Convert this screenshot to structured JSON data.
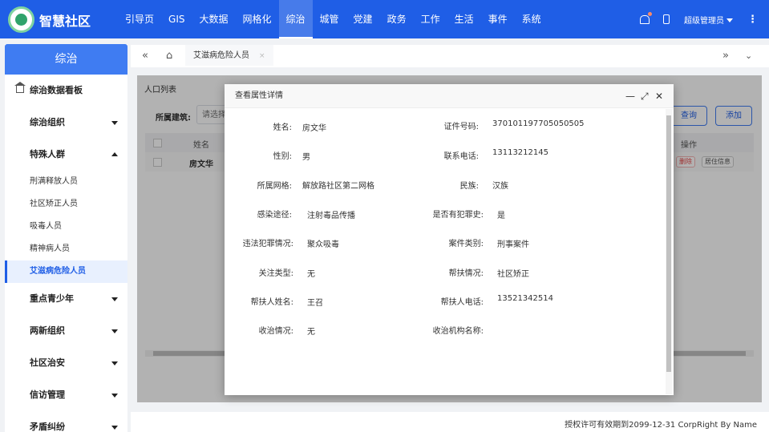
{
  "app": {
    "brand": "智慧社区"
  },
  "nav": [
    {
      "label": "引导页"
    },
    {
      "label": "GIS"
    },
    {
      "label": "大数据"
    },
    {
      "label": "网格化"
    },
    {
      "label": "综治",
      "active": true
    },
    {
      "label": "城管"
    },
    {
      "label": "党建"
    },
    {
      "label": "政务"
    },
    {
      "label": "工作"
    },
    {
      "label": "生活"
    },
    {
      "label": "事件"
    },
    {
      "label": "系统"
    }
  ],
  "user": {
    "name": "超级管理员"
  },
  "sidebar": {
    "title": "综治",
    "dashboard": "综治数据看板",
    "groups": {
      "org": "综治组织",
      "special": "特殊人群",
      "youth": "重点青少年",
      "twonew": "两新组织",
      "security": "社区治安",
      "petition": "信访管理",
      "conflict": "矛盾纠纷"
    },
    "sub": [
      "刑满释放人员",
      "社区矫正人员",
      "吸毒人员",
      "精神病人员",
      "艾滋病危险人员"
    ]
  },
  "tabs": {
    "current": "艾滋病危险人员",
    "close": "×"
  },
  "list": {
    "title": "人口列表",
    "filter_label": "所属建筑:",
    "filter_placeholder": "请选择",
    "query": "查询",
    "add": "添加",
    "col_name": "姓名",
    "col_op": "操作",
    "row_name": "房文华",
    "op_delete": "删除",
    "op_residence": "居住信息"
  },
  "modal": {
    "title": "查看属性详情",
    "fields": [
      {
        "label": "姓名:",
        "value": "房文华"
      },
      {
        "label": "证件号码:",
        "value": "370101197705050505"
      },
      {
        "label": "性别:",
        "value": "男"
      },
      {
        "label": "联系电话:",
        "value": "13113212145"
      },
      {
        "label": "所属网格:",
        "value": "解放路社区第二网格"
      },
      {
        "label": "民族:",
        "value": "汉族"
      },
      {
        "label": "感染途径:",
        "value": "注射毒品传播"
      },
      {
        "label": "是否有犯罪史:",
        "value": "是"
      },
      {
        "label": "违法犯罪情况:",
        "value": "聚众吸毒"
      },
      {
        "label": "案件类别:",
        "value": "刑事案件"
      },
      {
        "label": "关注类型:",
        "value": "无"
      },
      {
        "label": "帮扶情况:",
        "value": "社区矫正"
      },
      {
        "label": "帮扶人姓名:",
        "value": "王召"
      },
      {
        "label": "帮扶人电话:",
        "value": "13521342514"
      },
      {
        "label": "收治情况:",
        "value": "无"
      },
      {
        "label": "收治机构名称:",
        "value": ""
      }
    ]
  },
  "footer": {
    "copyright": "授权许可有效期到2099-12-31 CorpRight By Name"
  }
}
